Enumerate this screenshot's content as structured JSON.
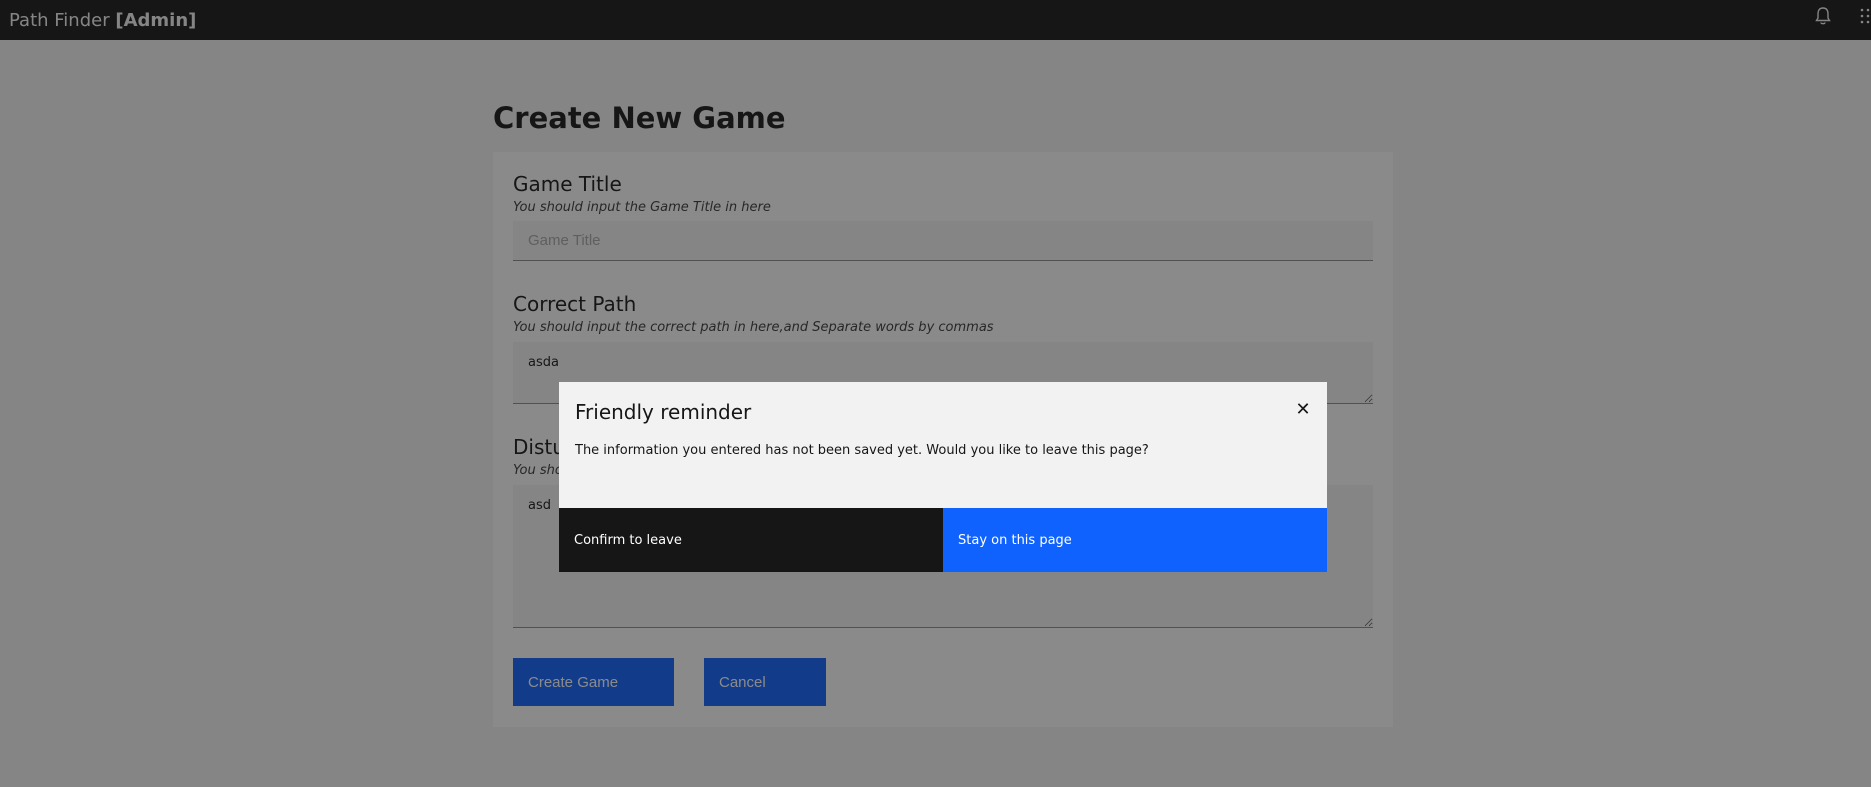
{
  "app": {
    "brand_name": "Path Finder",
    "brand_role": "[Admin]"
  },
  "icons": {
    "notifications": "bell-icon",
    "app_switcher": "grid-icon",
    "close": "close-icon"
  },
  "colors": {
    "header_bg": "#161616",
    "primary": "#0f62fe",
    "secondary": "#161616",
    "page_bg": "#f4f4f4"
  },
  "page": {
    "title": "Create New Game"
  },
  "form": {
    "game_title": {
      "label": "Game Title",
      "help": "You should input the Game Title in here",
      "placeholder": "Game Title",
      "value": ""
    },
    "correct_path": {
      "label": "Correct Path",
      "help": "You should input the correct path in here,and Separate words by commas",
      "value": "asda"
    },
    "disturb": {
      "label": "Distu",
      "help": "You sho",
      "value": "asd"
    },
    "create_label": "Create Game",
    "cancel_label": "Cancel"
  },
  "modal": {
    "title": "Friendly reminder",
    "body": "The information you entered has not been saved yet. Would you like to leave this page?",
    "confirm_label": "Confirm to leave",
    "stay_label": "Stay on this page"
  }
}
